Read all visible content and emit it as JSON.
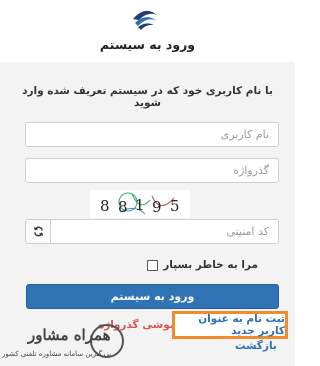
{
  "header": {
    "title": "ورود به سیستم"
  },
  "form": {
    "intro": "با نام کاربری خود که در سیستم تعریف شده وارد شوید",
    "username_placeholder": "نام کاربری",
    "password_placeholder": "گذرواژه",
    "captcha_digits": [
      "8",
      "8",
      "1",
      "9",
      "5"
    ],
    "captcha_placeholder": "کد امنیتی",
    "remember_label": "مرا به خاطر بسپار",
    "login_label": "ورود به سیستم"
  },
  "links": {
    "register": "ثبت نام به عنوان کاربر جدید",
    "forgot": "فراموشی گذرواژه",
    "back": "بازگشت"
  },
  "watermark": {
    "brand": "همراه مشاور",
    "subtitle": "بزرگترین سامانه مشاوره تلفنی کشور"
  },
  "colors": {
    "primary": "#2f73b4",
    "link": "#2f6fb6",
    "forgot": "#d9534f",
    "highlight": "#f08c2b",
    "panel_bg": "#f3f3f3"
  }
}
